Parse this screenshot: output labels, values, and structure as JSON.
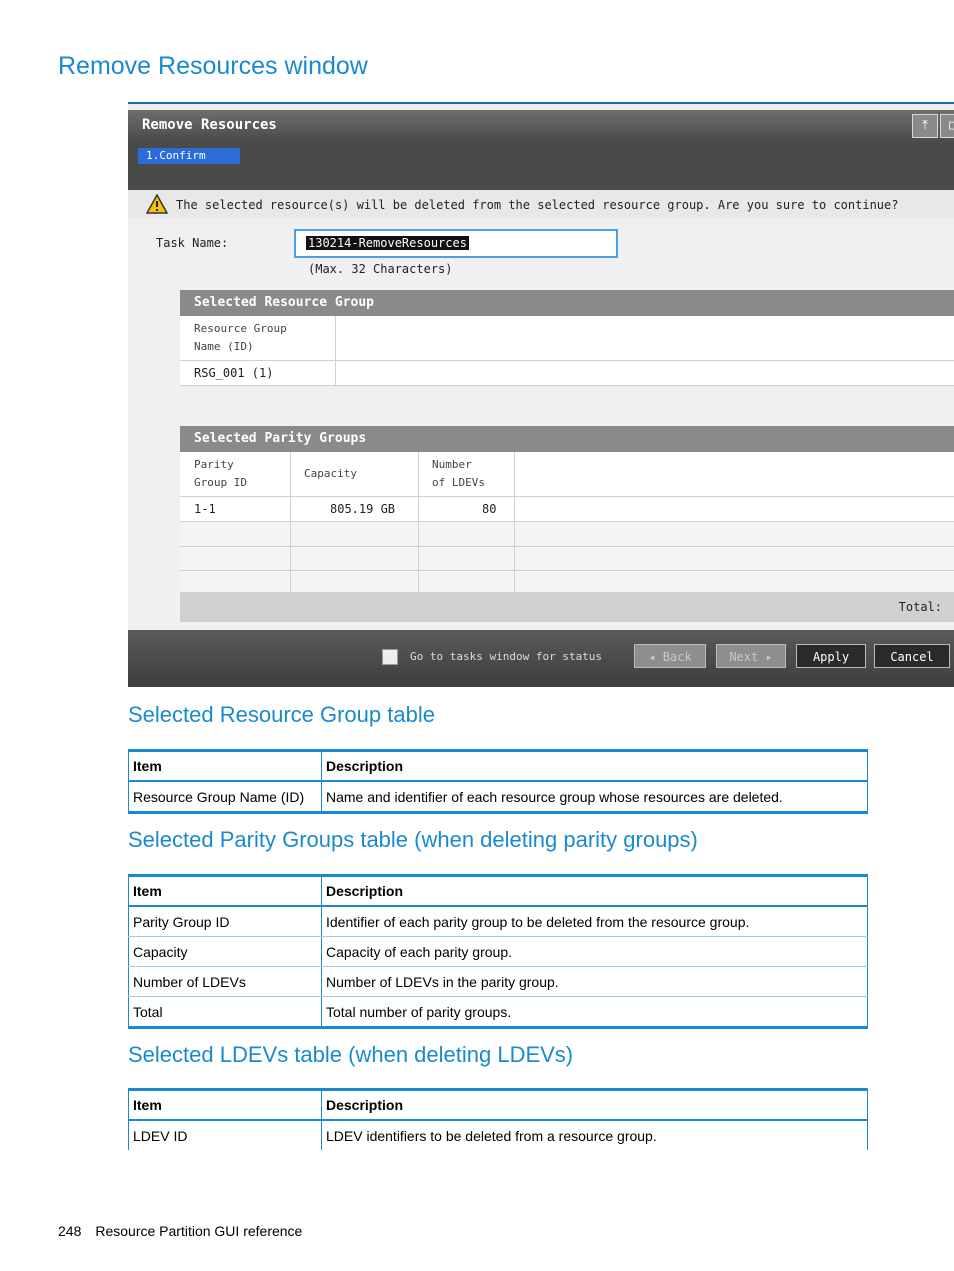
{
  "page_title": "Remove Resources window",
  "window": {
    "title": "Remove Resources",
    "step_label": "1.Confirm",
    "warning": "The selected resource(s) will be deleted from the selected resource group. Are you sure to continue?",
    "task_name_label": "Task Name:",
    "task_name_value": "130214-RemoveResources",
    "task_name_hint": "(Max. 32 Characters)",
    "resource_group_section": {
      "title": "Selected Resource Group",
      "header_line1": "Resource Group",
      "header_line2": "Name (ID)",
      "row_value": "RSG_001 (1)"
    },
    "parity_section": {
      "title": "Selected Parity Groups",
      "col1_line1": "Parity",
      "col1_line2": "Group ID",
      "col2": "Capacity",
      "col3_line1": "Number",
      "col3_line2": "of LDEVs",
      "row": {
        "id": "1-1",
        "capacity": "805.19 GB",
        "ldevs": "80"
      },
      "total_label": "Total:"
    },
    "footer": {
      "checkbox_label": "Go to tasks window for status",
      "back": "Back",
      "next": "Next",
      "apply": "Apply",
      "cancel": "Cancel"
    }
  },
  "sections": {
    "rg": {
      "heading": "Selected Resource Group table",
      "col_item": "Item",
      "col_desc": "Description",
      "rows": [
        {
          "item": "Resource Group Name (ID)",
          "desc": "Name and identifier of each resource group whose resources are deleted."
        }
      ]
    },
    "pg": {
      "heading": "Selected Parity Groups table (when deleting parity groups)",
      "col_item": "Item",
      "col_desc": "Description",
      "rows": [
        {
          "item": "Parity Group ID",
          "desc": "Identifier of each parity group to be deleted from the resource group."
        },
        {
          "item": "Capacity",
          "desc": "Capacity of each parity group."
        },
        {
          "item": "Number of LDEVs",
          "desc": "Number of LDEVs in the parity group."
        },
        {
          "item": "Total",
          "desc": "Total number of parity groups."
        }
      ]
    },
    "ld": {
      "heading": "Selected LDEVs table (when deleting LDEVs)",
      "col_item": "Item",
      "col_desc": "Description",
      "rows": [
        {
          "item": "LDEV ID",
          "desc": "LDEV identifiers to be deleted from a resource group."
        }
      ]
    }
  },
  "footer": {
    "page_number": "248",
    "text": "Resource Partition GUI reference"
  }
}
